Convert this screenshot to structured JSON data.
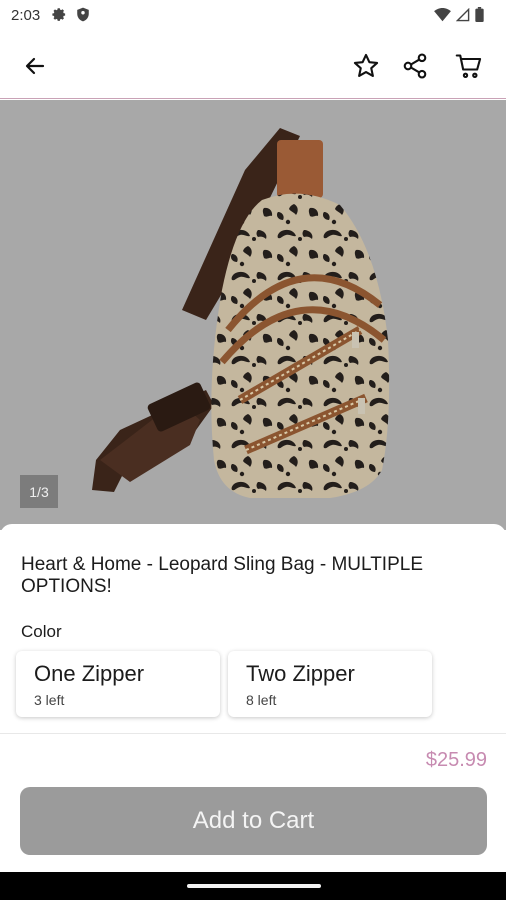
{
  "status_bar": {
    "time": "2:03",
    "left_icons": [
      "gear-icon",
      "shield-icon"
    ],
    "right_icons": [
      "wifi-icon",
      "cell-signal-icon",
      "battery-icon"
    ]
  },
  "app_bar": {
    "back_icon": "arrow-left-icon",
    "actions": [
      "star-icon",
      "share-icon",
      "cart-icon"
    ],
    "divider_color": "#c9a2b6"
  },
  "gallery": {
    "counter": "1/3",
    "background": "#a8a8a8"
  },
  "product": {
    "title": "Heart & Home - Leopard Sling Bag - MULTIPLE OPTIONS!",
    "color_label": "Color",
    "options": [
      {
        "name": "One Zipper",
        "stock": "3 left"
      },
      {
        "name": "Two Zipper",
        "stock": "8 left"
      }
    ],
    "price": "$25.99",
    "price_color": "#c78bb1",
    "add_to_cart_label": "Add to Cart"
  }
}
